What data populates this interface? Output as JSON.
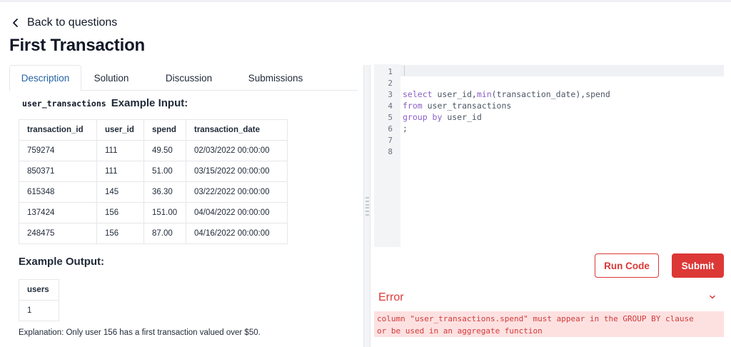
{
  "header": {
    "back_label": "Back to questions",
    "title": "First Transaction"
  },
  "tabs": [
    {
      "label": "Description",
      "active": true
    },
    {
      "label": "Solution",
      "active": false
    },
    {
      "label": "Discussion",
      "active": false
    },
    {
      "label": "Submissions",
      "active": false
    }
  ],
  "example_input": {
    "table_name": "user_transactions",
    "label": "Example Input:",
    "columns": [
      "transaction_id",
      "user_id",
      "spend",
      "transaction_date"
    ],
    "rows": [
      [
        "759274",
        "111",
        "49.50",
        "02/03/2022 00:00:00"
      ],
      [
        "850371",
        "111",
        "51.00",
        "03/15/2022 00:00:00"
      ],
      [
        "615348",
        "145",
        "36.30",
        "03/22/2022 00:00:00"
      ],
      [
        "137424",
        "156",
        "151.00",
        "04/04/2022 00:00:00"
      ],
      [
        "248475",
        "156",
        "87.00",
        "04/16/2022 00:00:00"
      ]
    ]
  },
  "example_output": {
    "label": "Example Output:",
    "columns": [
      "users"
    ],
    "rows": [
      [
        "1"
      ]
    ]
  },
  "explanation": "Explanation: Only user 156 has a first transaction valued over $50.",
  "editor": {
    "line_numbers": [
      "1",
      "2",
      "3",
      "4",
      "5",
      "6",
      "7",
      "8"
    ],
    "lines": [
      {
        "parts": []
      },
      {
        "parts": []
      },
      {
        "parts": [
          {
            "t": "select ",
            "kw": true
          },
          {
            "t": "user_id,",
            "kw": false
          },
          {
            "t": "min",
            "kw": true
          },
          {
            "t": "(transaction_date),spend",
            "kw": false
          }
        ]
      },
      {
        "parts": [
          {
            "t": "from ",
            "kw": true
          },
          {
            "t": "user_transactions",
            "kw": false
          }
        ]
      },
      {
        "parts": [
          {
            "t": "group by ",
            "kw": true
          },
          {
            "t": "user_id",
            "kw": false
          }
        ]
      },
      {
        "parts": [
          {
            "t": ";",
            "kw": false
          }
        ]
      },
      {
        "parts": []
      },
      {
        "parts": []
      }
    ]
  },
  "actions": {
    "run_label": "Run Code",
    "submit_label": "Submit"
  },
  "error": {
    "heading": "Error",
    "line1": "column \"user_transactions.spend\" must appear in the GROUP BY clause",
    "line2": "or be used in an aggregate function"
  },
  "colors": {
    "accent_red": "#dc3836",
    "active_tab": "#2563a6",
    "keyword": "#8b5fc7",
    "error_bg": "#fde1e1"
  },
  "icons": {
    "back": "chevron-left-icon",
    "error_toggle": "chevron-down-icon",
    "splitter": "drag-handle-icon"
  }
}
